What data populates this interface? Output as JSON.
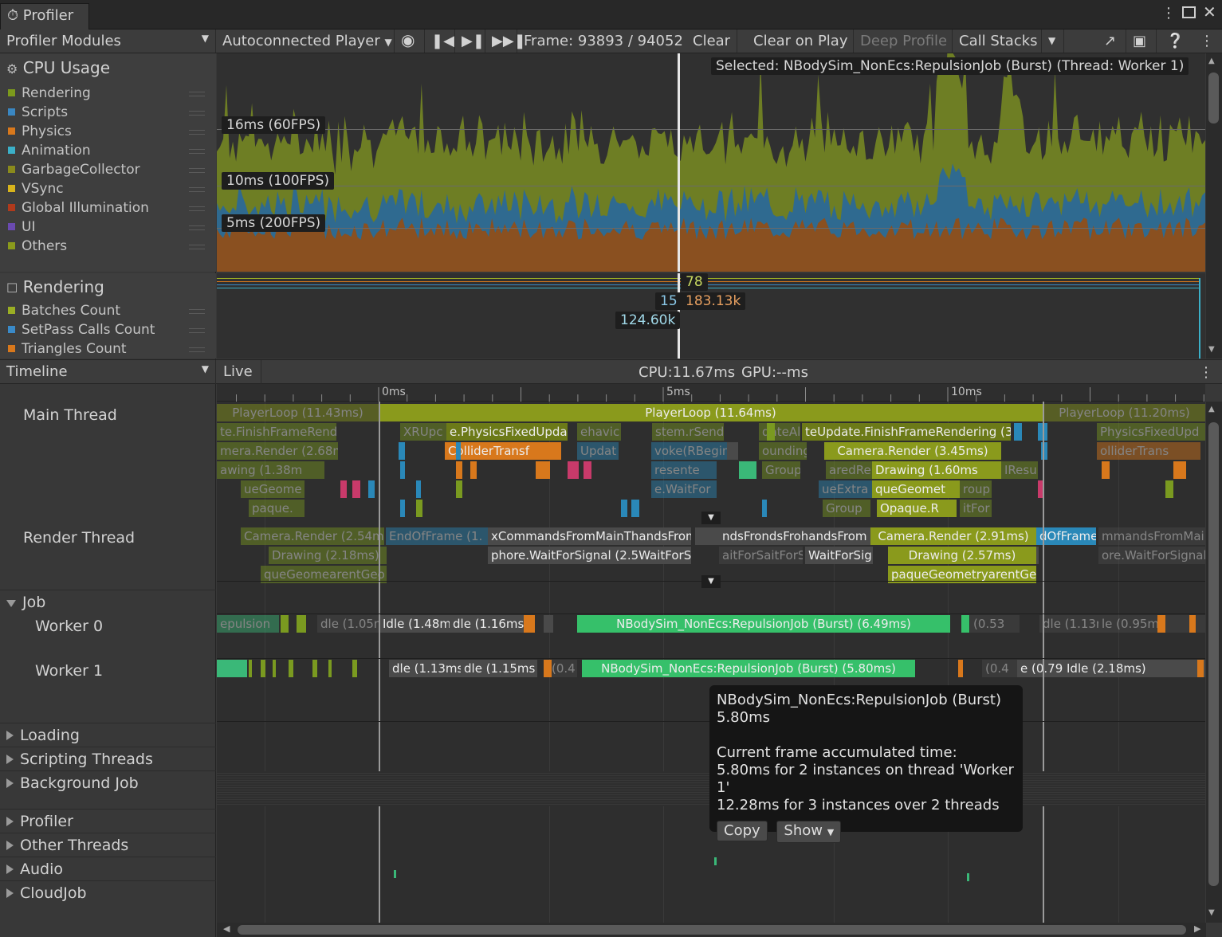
{
  "window": {
    "title": "Profiler"
  },
  "toolbar": {
    "modules": "Profiler Modules",
    "player": "Autoconnected Player",
    "frame": "Frame: 93893 / 94052",
    "clear": "Clear",
    "clear_on_play": "Clear on Play",
    "deep_profile": "Deep Profile",
    "call_stacks": "Call Stacks"
  },
  "cpu": {
    "title": "CPU Usage",
    "legend": [
      {
        "label": "Rendering",
        "color": "#7c9a1c"
      },
      {
        "label": "Scripts",
        "color": "#3a87c2"
      },
      {
        "label": "Physics",
        "color": "#d8781c"
      },
      {
        "label": "Animation",
        "color": "#3bb0c8"
      },
      {
        "label": "GarbageCollector",
        "color": "#8a8a1c"
      },
      {
        "label": "VSync",
        "color": "#d8b41c"
      },
      {
        "label": "Global Illumination",
        "color": "#b03a1c"
      },
      {
        "label": "UI",
        "color": "#6a4ab0"
      },
      {
        "label": "Others",
        "color": "#8a9a1c"
      }
    ],
    "markers": {
      "m16": "16ms (60FPS)",
      "m10": "10ms (100FPS)",
      "m5": "5ms (200FPS)"
    },
    "selected": "Selected: NBodySim_NonEcs:RepulsionJob (Burst) (Thread: Worker 1)"
  },
  "rendering": {
    "title": "Rendering",
    "legend": [
      {
        "label": "Batches Count",
        "color": "#9aae24"
      },
      {
        "label": "SetPass Calls Count",
        "color": "#3a8ac8"
      },
      {
        "label": "Triangles Count",
        "color": "#d8781c"
      }
    ],
    "values": {
      "batches": "78",
      "setpass": "15",
      "triangles": "183.13k",
      "vertices": "124.60k"
    }
  },
  "timeline": {
    "view": "Timeline",
    "live": "Live",
    "cpu": "CPU:11.67ms",
    "gpu": "GPU:--ms",
    "ruler": [
      "0ms",
      "5ms",
      "10ms"
    ],
    "main_thread": "Main Thread",
    "render_thread": "Render Thread",
    "job": "Job",
    "worker0": "Worker 0",
    "worker1": "Worker 1",
    "groups": [
      "Loading",
      "Scripting Threads",
      "Background Job",
      "Profiler",
      "Other Threads",
      "Audio",
      "CloudJob"
    ],
    "bars": {
      "pl_prev": "PlayerLoop (11.43ms)",
      "pl": "PlayerLoop (11.64ms)",
      "pl_next": "PlayerLoop (11.20ms)",
      "m2a": "te.FinishFrameRende",
      "m2b": "XRUpc",
      "m2c": "e.PhysicsFixedUpda",
      "m2d": "ehavic",
      "m2e": "stem.rSendF",
      "m2f": "dateAll",
      "m2g": "teUpdate.FinishFrameRendering (3",
      "m2h": "PhysicsFixedUpd",
      "m3a": "mera.Render (2.68m",
      "m3b": "ColliderTransf",
      "m3c": "Updat",
      "m3d": "voke(RBegin",
      "m3e": "ounding",
      "m3f": "Camera.Render (3.45ms)",
      "m3g": "olliderTrans",
      "m4a": "awing (1.38m",
      "m4b": "resente",
      "m4c": "Group",
      "m4d": "aredRen",
      "m4e": "Drawing (1.60ms",
      "m4f": "IResult",
      "m5a": "ueGeome",
      "m5b": "e.WaitFor",
      "m5c": "ueExtra",
      "m5d": "queGeomet",
      "m5e": "roup",
      "m6a": "paque.",
      "m6b": "Group",
      "m6c": "Opaque.R",
      "m6d": "itFor",
      "r1a": "Camera.Render (2.54ms",
      "r1b": "EndOfFrame (1.",
      "r1c": "xCommandsFromMainThandsFrom",
      "r1d": "ndsFrondsFrohandsFrom",
      "r1e": "Camera.Render (2.91ms)",
      "r1f": "dOfFrame",
      "r1g": "mmandsFromMai",
      "r2a": "Drawing (2.18ms)",
      "r2b": "phore.WaitForSignal (2.5WaitForSig",
      "r2c": "aitForSaitForS",
      "r2d": "WaitForSig",
      "r2e": "Drawing (2.57ms)",
      "r2f": "ore.WaitForSignal",
      "r3a": "queGeomearentGeo",
      "r3b": "paqueGeometryarentGeon",
      "w0a": "epulsion",
      "w0b": "dle (1.05ms",
      "w0c": "Idle (1.48ms)",
      "w0d": "dle (1.16ms",
      "w0e": "NBodySim_NonEcs:RepulsionJob (Burst) (6.49ms)",
      "w0f": "(0.53",
      "w0g": "dle (1.13ms",
      "w0h": "le (0.95m",
      "w1a": "dle (1.13ms",
      "w1b": "dle (1.15ms",
      "w1c": "(0.4",
      "w1d": "NBodySim_NonEcs:RepulsionJob (Burst) (5.80ms)",
      "w1e": "(0.4",
      "w1f": "e (0.79m",
      "w1g": "Idle (2.18ms)"
    }
  },
  "tooltip": {
    "name": "NBodySim_NonEcs:RepulsionJob (Burst)",
    "duration": "5.80ms",
    "heading": "Current frame accumulated time:",
    "line1": "5.80ms for 2 instances on thread 'Worker 1'",
    "line2": "12.28ms for 3 instances over 2 threads",
    "copy": "Copy",
    "show": "Show"
  }
}
